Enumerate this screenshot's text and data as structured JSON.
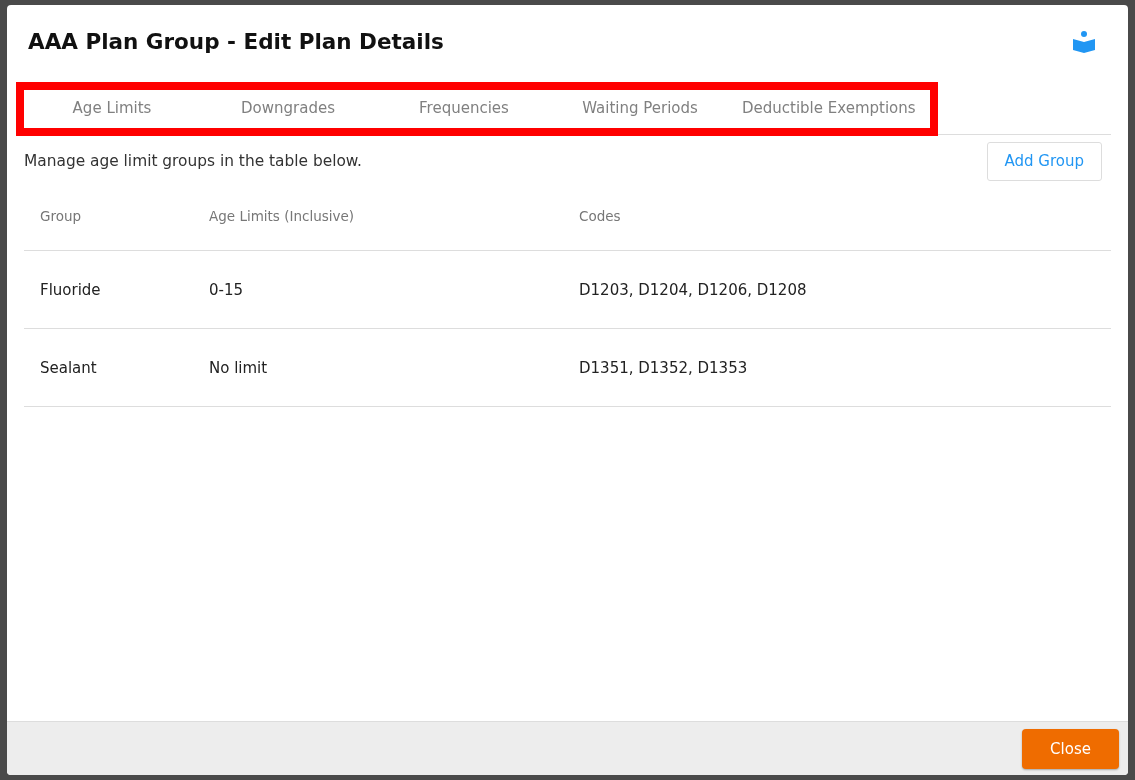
{
  "dialog": {
    "title": "AAA Plan Group - Edit Plan Details"
  },
  "annotation": {
    "tabs_highlighted": true
  },
  "tabs": [
    {
      "label": "Age Limits",
      "selected": false
    },
    {
      "label": "Downgrades",
      "selected": false
    },
    {
      "label": "Frequencies",
      "selected": false
    },
    {
      "label": "Waiting Periods",
      "selected": false
    },
    {
      "label": "Deductible Exemptions",
      "selected": false
    }
  ],
  "description": "Manage age limit groups in the table below.",
  "add_button": "Add Group",
  "table": {
    "columns": [
      "Group",
      "Age Limits (Inclusive)",
      "Codes"
    ],
    "rows": [
      [
        "Fluoride",
        "0-15",
        "D1203, D1204, D1206, D1208"
      ],
      [
        "Sealant",
        "No limit",
        "D1351, D1352, D1353"
      ]
    ]
  },
  "footer": {
    "buttons": [
      "Close"
    ]
  }
}
